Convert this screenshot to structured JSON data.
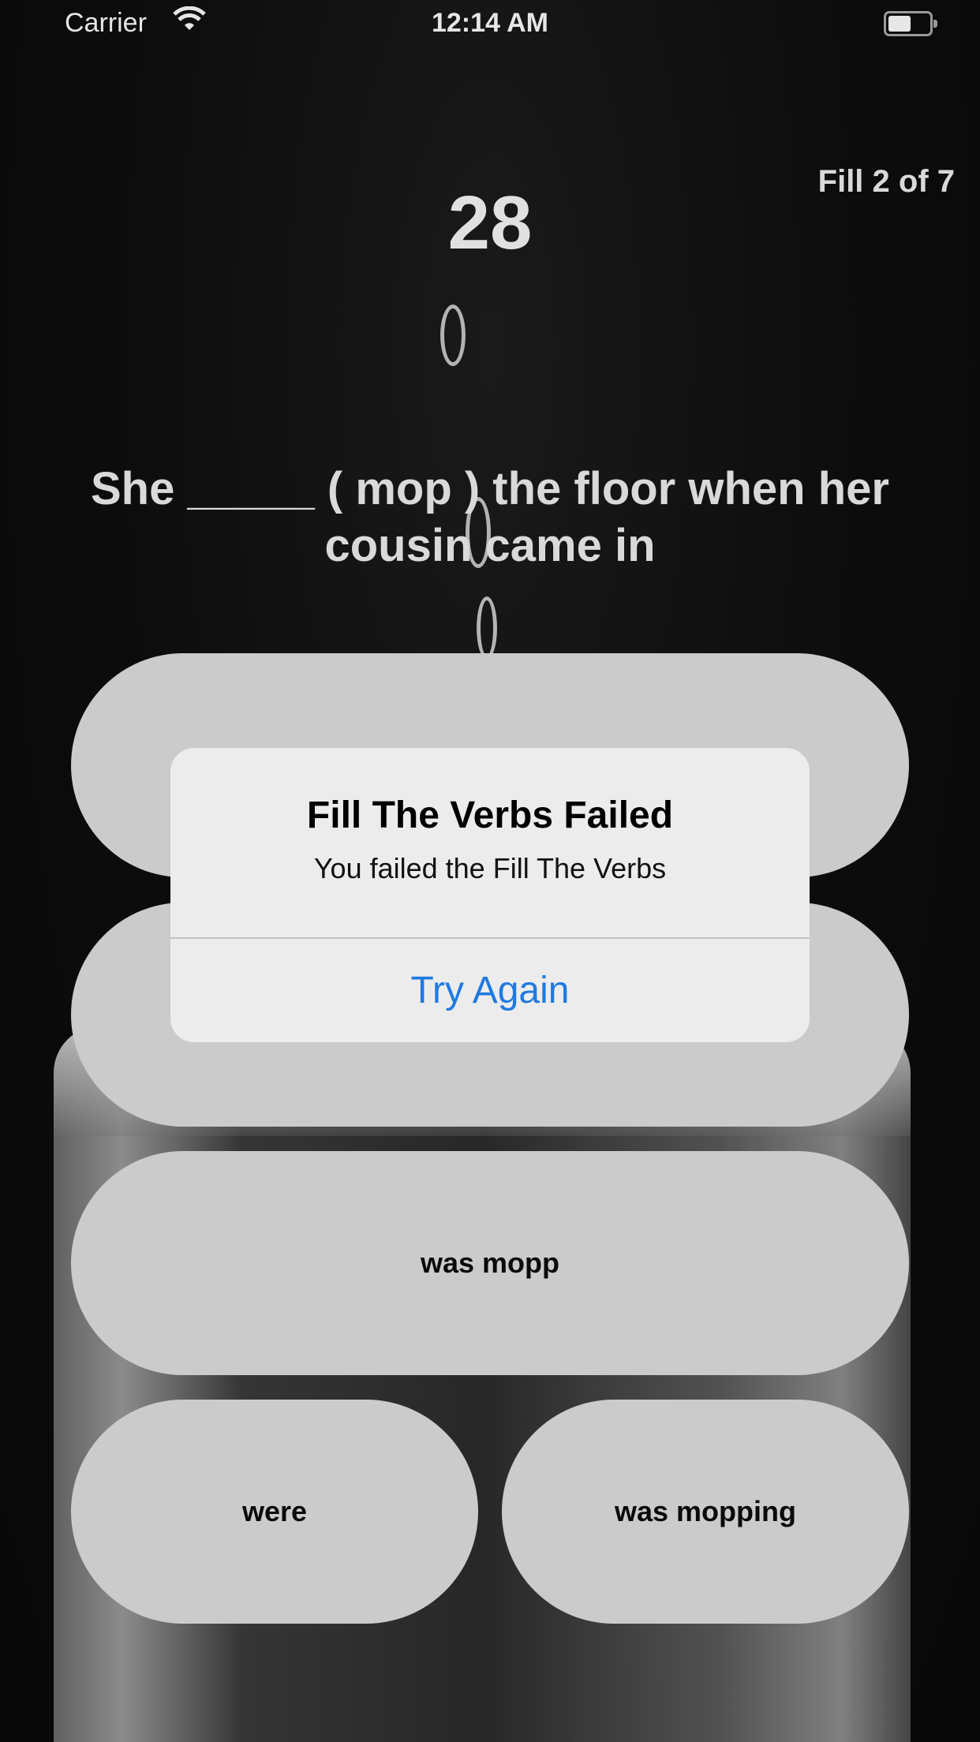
{
  "status_bar": {
    "carrier": "Carrier",
    "time": "12:14 AM"
  },
  "game": {
    "progress": "Fill 2 of 7",
    "counter": "28",
    "question": "She _____ ( mop ) the floor when her cousin came in",
    "answers": [
      "",
      "",
      "was mopp",
      "were",
      "was mopping"
    ]
  },
  "alert": {
    "title": "Fill The Verbs Failed",
    "message": "You failed the Fill The Verbs",
    "button": "Try Again"
  },
  "colors": {
    "accent": "#1f7ae0",
    "answer_bg": "#cbcbcb",
    "alert_bg": "#ececec"
  }
}
